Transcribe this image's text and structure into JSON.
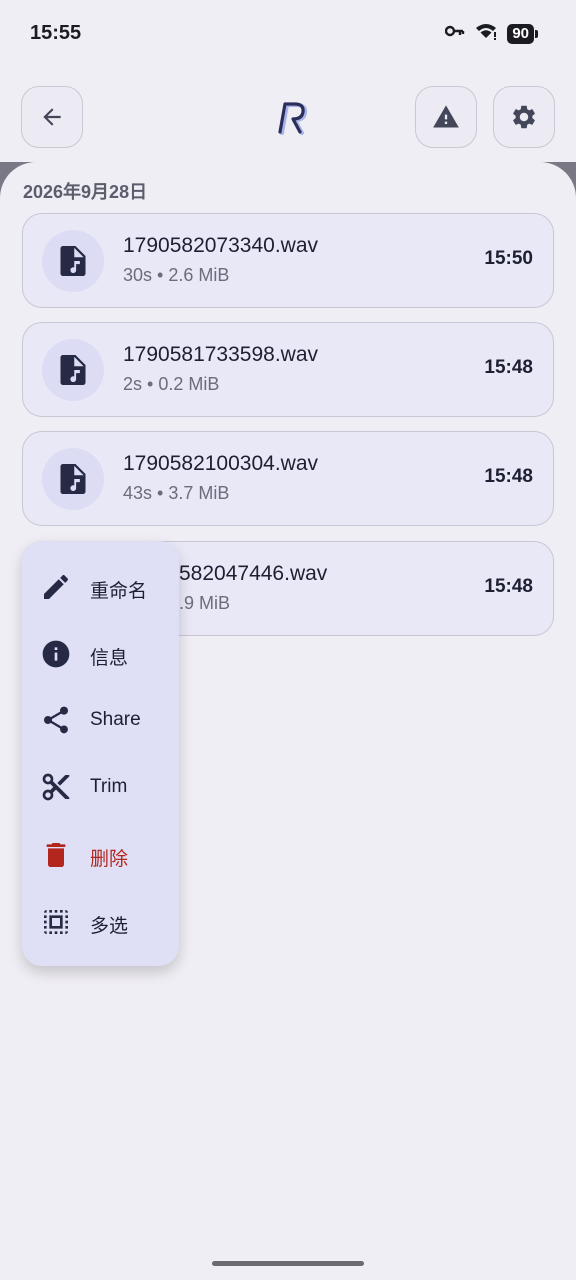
{
  "status_bar": {
    "time": "15:55",
    "battery": "90"
  },
  "top_bar": {
    "back_label": "back",
    "warning_label": "warning",
    "settings_label": "settings"
  },
  "list": {
    "date_header": "2026年9月28日",
    "recordings": [
      {
        "name": "1790582073340.wav",
        "meta": "30s • 2.6 MiB",
        "time": "15:50"
      },
      {
        "name": "1790581733598.wav",
        "meta": "2s • 0.2 MiB",
        "time": "15:48"
      },
      {
        "name": "1790582100304.wav",
        "meta": "43s • 3.7 MiB",
        "time": "15:48"
      },
      {
        "name": "582047446.wav",
        "meta": ".9 MiB",
        "time": "15:48"
      }
    ]
  },
  "context_menu": {
    "items": [
      {
        "label": "重命名",
        "icon": "pencil-icon"
      },
      {
        "label": "信息",
        "icon": "info-icon"
      },
      {
        "label": "Share",
        "icon": "share-icon"
      },
      {
        "label": "Trim",
        "icon": "scissors-icon"
      },
      {
        "label": "删除",
        "icon": "trash-icon"
      },
      {
        "label": "多选",
        "icon": "select-all-icon"
      }
    ]
  },
  "colors": {
    "danger": "#b3261e",
    "accent": "#dcdcf5",
    "text": "#1d1f33"
  }
}
